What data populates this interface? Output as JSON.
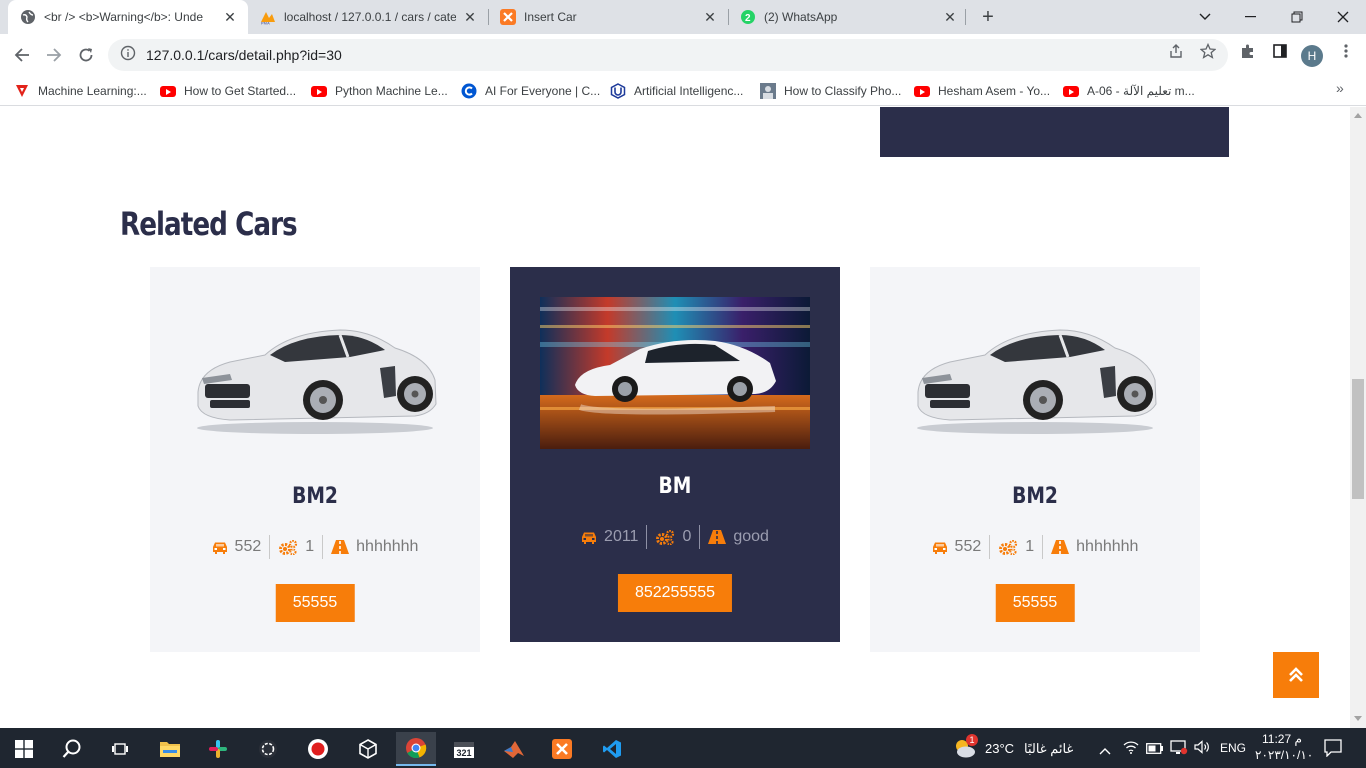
{
  "browser": {
    "tabs": [
      {
        "title": "<br /> <b>Warning</b>: Unde",
        "active": true
      },
      {
        "title": "localhost / 127.0.0.1 / cars / cate",
        "active": false
      },
      {
        "title": "Insert Car",
        "active": false
      },
      {
        "title": "(2) WhatsApp",
        "active": false
      }
    ],
    "url": "127.0.0.1/cars/detail.php?id=30",
    "profile_initial": "H",
    "bookmarks": [
      {
        "label": "Machine Learning:...",
        "icon": "triangle-icon"
      },
      {
        "label": "How to Get Started...",
        "icon": "youtube-icon"
      },
      {
        "label": "Python Machine Le...",
        "icon": "youtube-icon"
      },
      {
        "label": "AI For Everyone | C...",
        "icon": "coursera-icon"
      },
      {
        "label": "Artificial Intelligenc...",
        "icon": "udacity-icon"
      },
      {
        "label": "How to Classify Pho...",
        "icon": "site-icon"
      },
      {
        "label": "Hesham Asem - Yo...",
        "icon": "youtube-icon"
      },
      {
        "label": "A-06 - تعليم الآلة m...",
        "icon": "youtube-icon"
      }
    ]
  },
  "page": {
    "related_title": "Related Cars",
    "cars": [
      {
        "name": "BM2",
        "year": "552",
        "seats": "1",
        "condition": "hhhhhhh",
        "price": "55555",
        "image": "silver-sports-car",
        "highlighted": false
      },
      {
        "name": "BM",
        "year": "2011",
        "seats": "0",
        "condition": "good",
        "price": "852255555",
        "image": "white-sedan-motion",
        "highlighted": true
      },
      {
        "name": "BM2",
        "year": "552",
        "seats": "1",
        "condition": "hhhhhhh",
        "price": "55555",
        "image": "silver-sports-car",
        "highlighted": false
      }
    ]
  },
  "taskbar": {
    "weather_temp": "23°C",
    "weather_desc": "غائم غالبًا",
    "weather_badge": "1",
    "language": "ENG",
    "time": "11:27 م",
    "date": "٢٠٢٣/١٠/١٠"
  },
  "colors": {
    "accent": "#f77d0a",
    "navy": "#2b2e4a",
    "card_bg": "#f4f5f8"
  }
}
